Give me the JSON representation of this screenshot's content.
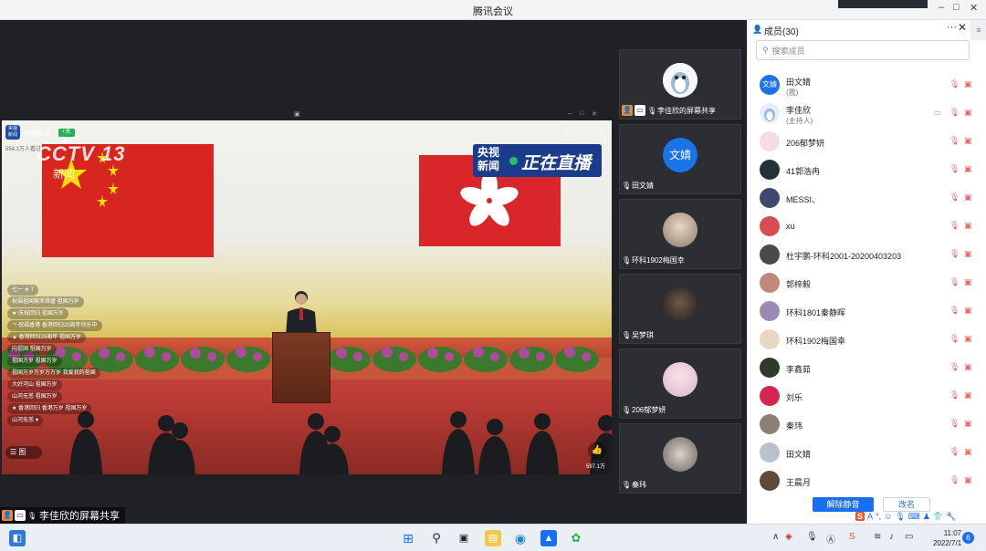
{
  "window": {
    "title": "腾讯会议",
    "min": "–",
    "max": "□",
    "close": "✕"
  },
  "video": {
    "channel_name": "央视新闻",
    "channel_icon_text": "央视 新闻",
    "follow": "+关注",
    "viewers": "554.1万人看过",
    "cctv_logo": "CCTV 13",
    "cctv_sub": "新闻",
    "live_yang": "央视",
    "live_xinwen": "新闻",
    "live_text": "正在直播",
    "like_count": "597.1万",
    "chat": [
      "七一 ★ 7",
      "祝福祖国繁荣昌盛  祖国万岁",
      "★ 庆祝回归  祖国万岁",
      "ㄱ 祝福香港  香港回归25周年快乐中",
      "▲ 香港回归25周年  祖国万岁",
      "向祖国  祖国万岁",
      "祖国万岁  祖国万岁",
      "祖国万岁万岁万万岁  我爱我的祖国",
      "大好河山  祖国万岁",
      "山河无恙  祖国万岁",
      "★ 香港回归  香港万岁  祖国万岁",
      "山河无恙 ♥"
    ],
    "list_btn": "☰ 图"
  },
  "share_label": "李佳欣的屏幕共享",
  "thumbs": [
    {
      "name": "李佳欣的屏幕共享",
      "avatar": "penguin"
    },
    {
      "name": "田文婧",
      "avatar": "文婧"
    },
    {
      "name": "环科1902梅国幸",
      "avatar": "photo"
    },
    {
      "name": "吴梦琪",
      "avatar": "photo"
    },
    {
      "name": "206郁梦妍",
      "avatar": "anime"
    },
    {
      "name": "秦玮",
      "avatar": "photo"
    }
  ],
  "members_panel": {
    "title": "成员(30)",
    "more": "···",
    "close": "✕",
    "search_placeholder": "搜索成员",
    "members": [
      {
        "name": "田文婧",
        "role": "(我)",
        "avatar": "文婧"
      },
      {
        "name": "李佳欣",
        "role": "(主持人)",
        "avatar": "penguin"
      },
      {
        "name": "206郁梦妍",
        "role": "",
        "avatar": "anime"
      },
      {
        "name": "41郭浩冉",
        "role": "",
        "avatar": "photo"
      },
      {
        "name": "MESSI、",
        "role": "",
        "avatar": "photo"
      },
      {
        "name": "xu",
        "role": "",
        "avatar": "photo"
      },
      {
        "name": "杜宇鹏-环科2001-20200403203",
        "role": "",
        "avatar": "photo"
      },
      {
        "name": "郭梓毅",
        "role": "",
        "avatar": "photo"
      },
      {
        "name": "环科1801秦静晖",
        "role": "",
        "avatar": "photo"
      },
      {
        "name": "环科1902梅国幸",
        "role": "",
        "avatar": "photo"
      },
      {
        "name": "李鑫茹",
        "role": "",
        "avatar": "photo"
      },
      {
        "name": "刘乐",
        "role": "",
        "avatar": "photo"
      },
      {
        "name": "秦玮",
        "role": "",
        "avatar": "photo"
      },
      {
        "name": "田文婧",
        "role": "",
        "avatar": "photo"
      },
      {
        "name": "王晨月",
        "role": "",
        "avatar": "photo"
      }
    ],
    "unmute_all": "解除静音",
    "rename": "改名"
  },
  "taskbar": {
    "time": "11:07",
    "date": "2022/7/1",
    "notifications": "6"
  },
  "colors": {
    "accent": "#1a6ef0",
    "muted_red": "#e56a6a"
  }
}
